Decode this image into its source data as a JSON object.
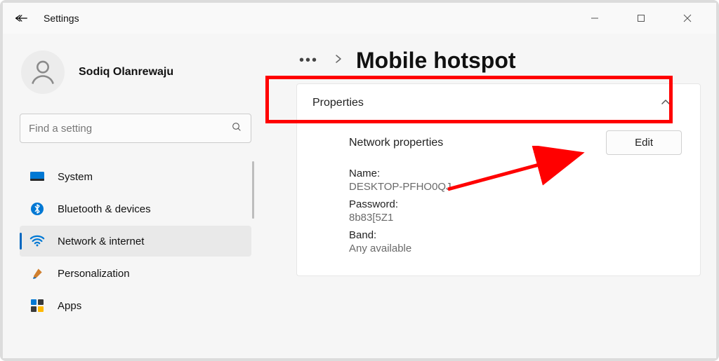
{
  "window": {
    "title": "Settings"
  },
  "user": {
    "name": "Sodiq Olanrewaju"
  },
  "search": {
    "placeholder": "Find a setting"
  },
  "sidebar": {
    "items": [
      {
        "label": "System",
        "icon": "system"
      },
      {
        "label": "Bluetooth & devices",
        "icon": "bluetooth"
      },
      {
        "label": "Network & internet",
        "icon": "wifi",
        "selected": true
      },
      {
        "label": "Personalization",
        "icon": "brush"
      },
      {
        "label": "Apps",
        "icon": "apps"
      }
    ]
  },
  "breadcrumb": {
    "page_title": "Mobile hotspot"
  },
  "properties": {
    "header": "Properties",
    "section_heading": "Network properties",
    "edit_label": "Edit",
    "fields": {
      "name_label": "Name:",
      "name_value": "DESKTOP-PFHO0QJ",
      "password_label": "Password:",
      "password_value": "8b83[5Z1",
      "band_label": "Band:",
      "band_value": "Any available"
    }
  },
  "annotation": {
    "highlight_color": "#ff0000"
  }
}
